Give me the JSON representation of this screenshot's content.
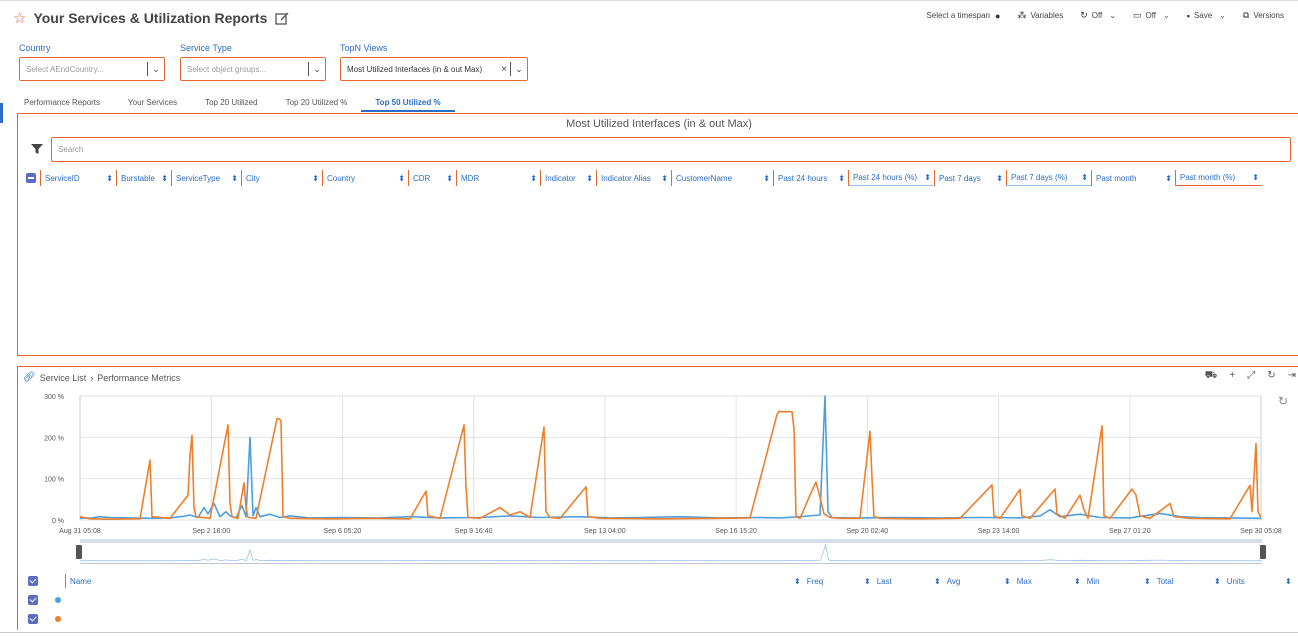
{
  "header": {
    "title": "Your Services & Utilization Reports",
    "toolbar": {
      "timespan": "Select a timespan",
      "variables": "Variables",
      "refresh": "Off",
      "display": "Off",
      "save": "Save",
      "versions": "Versions"
    }
  },
  "filters": {
    "country": {
      "label": "Country",
      "placeholder": "Select AEndCountry..."
    },
    "service_type": {
      "label": "Service Type",
      "placeholder": "Select object groups..."
    },
    "topn": {
      "label": "TopN Views",
      "value": "Most Utilized Interfaces (in & out Max)"
    }
  },
  "tabs": [
    "Performance Reports",
    "Your Services",
    "Top 20 Utilized",
    "Top 20 Utilized %",
    "Top 50 Utilized %"
  ],
  "active_tab": 4,
  "table_panel": {
    "title": "Most Utilized Interfaces (in & out Max)",
    "search_placeholder": "Search",
    "columns": [
      "ServiceID",
      "Burstable",
      "ServiceType",
      "City",
      "Country",
      "CDR",
      "MDR",
      "Indicator",
      "Indicator Alias",
      "CustomerName",
      "Past 24 hours",
      "Past 24 hours (%)",
      "Past 7 days",
      "Past 7 days (%)",
      "Past month",
      "Past month (%)"
    ]
  },
  "metrics_panel": {
    "breadcrumb": [
      "Service List",
      "Performance Metrics"
    ]
  },
  "chart_data": {
    "type": "line",
    "y_ticks": [
      "300 %",
      "200 %",
      "100 %",
      "0 %"
    ],
    "ylim": [
      0,
      300
    ],
    "x_ticks": [
      "Aug 31 05:08",
      "Sep 2 18:00",
      "Sep 6 05:20",
      "Sep 9 16:40",
      "Sep 13 04:00",
      "Sep 16 15:20",
      "Sep 20 02:40",
      "Sep 23 14:00",
      "Sep 27 01:20",
      "Sep 30 05:08"
    ],
    "colors": {
      "series_blue": "#4e9fe0",
      "series_orange": "#f07f2c"
    },
    "series": [
      {
        "color_key": "series_blue",
        "points": [
          [
            0,
            4
          ],
          [
            12,
            5
          ],
          [
            20,
            8
          ],
          [
            30,
            6
          ],
          [
            50,
            5
          ],
          [
            70,
            4
          ],
          [
            90,
            5
          ],
          [
            100,
            8
          ],
          [
            104,
            9
          ],
          [
            110,
            12
          ],
          [
            118,
            6
          ],
          [
            124,
            30
          ],
          [
            128,
            15
          ],
          [
            134,
            40
          ],
          [
            140,
            8
          ],
          [
            146,
            20
          ],
          [
            150,
            10
          ],
          [
            156,
            5
          ],
          [
            162,
            35
          ],
          [
            166,
            8
          ],
          [
            170,
            200
          ],
          [
            173,
            10
          ],
          [
            176,
            30
          ],
          [
            180,
            8
          ],
          [
            190,
            14
          ],
          [
            200,
            6
          ],
          [
            210,
            10
          ],
          [
            230,
            5
          ],
          [
            260,
            6
          ],
          [
            300,
            5
          ],
          [
            330,
            8
          ],
          [
            360,
            5
          ],
          [
            400,
            6
          ],
          [
            430,
            10
          ],
          [
            460,
            6
          ],
          [
            500,
            8
          ],
          [
            530,
            5
          ],
          [
            560,
            6
          ],
          [
            600,
            8
          ],
          [
            640,
            5
          ],
          [
            680,
            6
          ],
          [
            700,
            5
          ],
          [
            720,
            8
          ],
          [
            740,
            12
          ],
          [
            745,
            300
          ],
          [
            748,
            20
          ],
          [
            752,
            6
          ],
          [
            780,
            5
          ],
          [
            820,
            6
          ],
          [
            860,
            5
          ],
          [
            900,
            6
          ],
          [
            940,
            5
          ],
          [
            960,
            10
          ],
          [
            970,
            25
          ],
          [
            980,
            8
          ],
          [
            1000,
            14
          ],
          [
            1020,
            6
          ],
          [
            1050,
            5
          ],
          [
            1080,
            16
          ],
          [
            1100,
            8
          ],
          [
            1120,
            6
          ],
          [
            1150,
            5
          ],
          [
            1181,
            4
          ]
        ]
      },
      {
        "color_key": "series_orange",
        "points": [
          [
            0,
            8
          ],
          [
            10,
            3
          ],
          [
            30,
            2
          ],
          [
            60,
            3
          ],
          [
            70,
            145
          ],
          [
            72,
            8
          ],
          [
            90,
            4
          ],
          [
            108,
            60
          ],
          [
            110,
            155
          ],
          [
            112,
            205
          ],
          [
            114,
            30
          ],
          [
            116,
            8
          ],
          [
            130,
            4
          ],
          [
            148,
            230
          ],
          [
            150,
            40
          ],
          [
            152,
            8
          ],
          [
            158,
            4
          ],
          [
            164,
            90
          ],
          [
            166,
            30
          ],
          [
            168,
            6
          ],
          [
            176,
            4
          ],
          [
            197,
            245
          ],
          [
            199,
            245
          ],
          [
            201,
            240
          ],
          [
            203,
            8
          ],
          [
            210,
            4
          ],
          [
            250,
            3
          ],
          [
            290,
            4
          ],
          [
            330,
            3
          ],
          [
            346,
            70
          ],
          [
            348,
            10
          ],
          [
            360,
            4
          ],
          [
            384,
            230
          ],
          [
            386,
            80
          ],
          [
            388,
            6
          ],
          [
            400,
            4
          ],
          [
            420,
            30
          ],
          [
            430,
            12
          ],
          [
            440,
            20
          ],
          [
            450,
            6
          ],
          [
            464,
            225
          ],
          [
            466,
            20
          ],
          [
            470,
            6
          ],
          [
            480,
            4
          ],
          [
            506,
            80
          ],
          [
            508,
            8
          ],
          [
            520,
            4
          ],
          [
            580,
            3
          ],
          [
            640,
            4
          ],
          [
            670,
            5
          ],
          [
            697,
            255
          ],
          [
            699,
            263
          ],
          [
            702,
            262
          ],
          [
            708,
            262
          ],
          [
            712,
            262
          ],
          [
            714,
            220
          ],
          [
            716,
            8
          ],
          [
            720,
            4
          ],
          [
            730,
            60
          ],
          [
            736,
            92
          ],
          [
            740,
            55
          ],
          [
            744,
            15
          ],
          [
            750,
            6
          ],
          [
            760,
            4
          ],
          [
            780,
            4
          ],
          [
            790,
            215
          ],
          [
            792,
            100
          ],
          [
            794,
            8
          ],
          [
            800,
            4
          ],
          [
            840,
            3
          ],
          [
            880,
            4
          ],
          [
            912,
            85
          ],
          [
            914,
            10
          ],
          [
            920,
            4
          ],
          [
            940,
            74
          ],
          [
            942,
            10
          ],
          [
            950,
            4
          ],
          [
            975,
            75
          ],
          [
            977,
            15
          ],
          [
            985,
            4
          ],
          [
            1000,
            60
          ],
          [
            1004,
            25
          ],
          [
            1008,
            4
          ],
          [
            1022,
            228
          ],
          [
            1024,
            10
          ],
          [
            1030,
            4
          ],
          [
            1052,
            75
          ],
          [
            1056,
            60
          ],
          [
            1060,
            10
          ],
          [
            1070,
            4
          ],
          [
            1090,
            40
          ],
          [
            1094,
            8
          ],
          [
            1110,
            4
          ],
          [
            1150,
            3
          ],
          [
            1170,
            84
          ],
          [
            1172,
            20
          ],
          [
            1176,
            185
          ],
          [
            1178,
            20
          ],
          [
            1181,
            6
          ]
        ]
      }
    ]
  },
  "legend_table": {
    "columns": [
      "Name",
      "Freq",
      "Last",
      "Avg",
      "Max",
      "Min",
      "Total",
      "Units"
    ],
    "rows": [
      {
        "color_key": "series_blue"
      },
      {
        "color_key": "series_orange"
      }
    ]
  }
}
